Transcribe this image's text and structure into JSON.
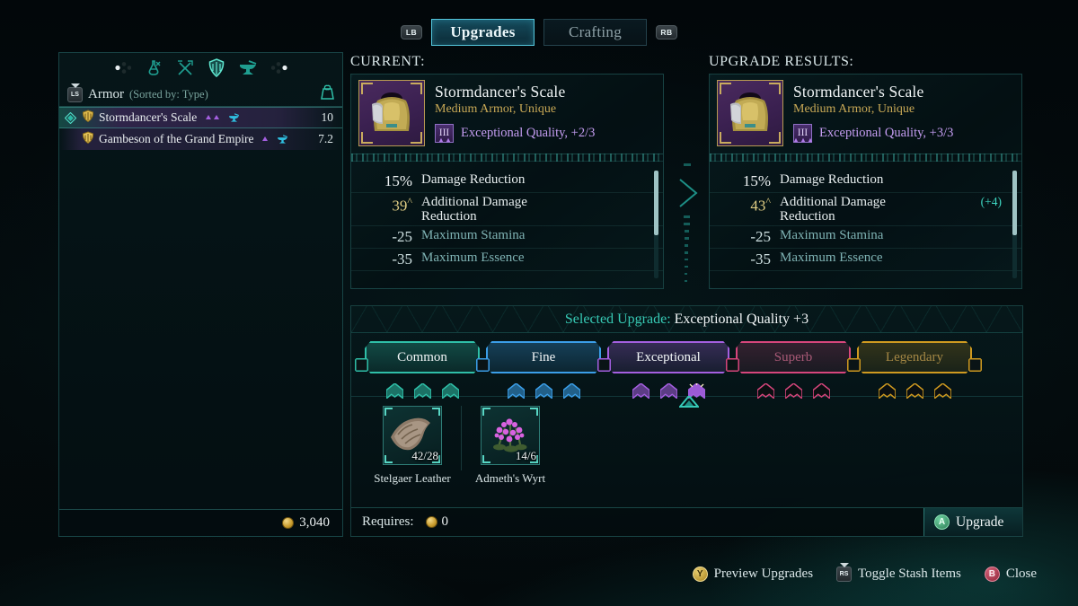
{
  "tabs": {
    "left_bumper": "LB",
    "right_bumper": "RB",
    "items": [
      {
        "label": "Upgrades",
        "active": true
      },
      {
        "label": "Crafting",
        "active": false
      }
    ]
  },
  "sidebar": {
    "categories": [
      {
        "name": "prev-category-arrow"
      },
      {
        "name": "potion-icon"
      },
      {
        "name": "weapons-icon"
      },
      {
        "name": "armor-icon"
      },
      {
        "name": "anvil-icon"
      },
      {
        "name": "next-category-arrow"
      }
    ],
    "sort": {
      "button": "LS",
      "label": "Armor",
      "sub": "(Sorted by: Type)"
    },
    "items": [
      {
        "name": "Stormdancer's Scale",
        "value": "10",
        "selected": true,
        "pips": 2
      },
      {
        "name": "Gambeson of the Grand Empire",
        "value": "7.2",
        "selected": false,
        "pips": 1
      }
    ],
    "gold": "3,040"
  },
  "current_panel": {
    "header": "CURRENT:",
    "item": {
      "title": "Stormdancer's Scale",
      "subtitle": "Medium Armor, Unique",
      "quality_rank": "III",
      "quality_pips": 2,
      "quality_text": "Exceptional Quality, +2/3"
    },
    "stats": [
      {
        "value": "15%",
        "label": "Damage Reduction",
        "value_style": "white",
        "label_style": "white",
        "delta": ""
      },
      {
        "value": "39",
        "caret": "^",
        "label": "Additional Damage Reduction",
        "value_style": "gold",
        "label_style": "white",
        "delta": ""
      },
      {
        "value": "-25",
        "label": "Maximum Stamina",
        "value_style": "teal",
        "label_style": "teal",
        "delta": ""
      },
      {
        "value": "-35",
        "label": "Maximum Essence",
        "value_style": "teal",
        "label_style": "teal",
        "delta": ""
      }
    ]
  },
  "results_panel": {
    "header": "UPGRADE RESULTS:",
    "item": {
      "title": "Stormdancer's Scale",
      "subtitle": "Medium Armor, Unique",
      "quality_rank": "III",
      "quality_pips": 3,
      "quality_text": "Exceptional Quality, +3/3"
    },
    "stats": [
      {
        "value": "15%",
        "label": "Damage Reduction",
        "value_style": "white",
        "label_style": "white",
        "delta": ""
      },
      {
        "value": "43",
        "caret": "^",
        "label": "Additional Damage Reduction",
        "value_style": "gold",
        "label_style": "white",
        "delta": "(+4)"
      },
      {
        "value": "-25",
        "label": "Maximum Stamina",
        "value_style": "teal",
        "label_style": "teal",
        "delta": ""
      },
      {
        "value": "-35",
        "label": "Maximum Essence",
        "value_style": "teal",
        "label_style": "teal",
        "delta": ""
      }
    ]
  },
  "upgrade": {
    "selected_label": "Selected Upgrade:",
    "selected_value": "Exceptional Quality +3",
    "tiers": [
      {
        "label": "Common",
        "color": "#2fbfa8",
        "filled": true,
        "dim": false,
        "chevrons": 3,
        "active_chevron": 0
      },
      {
        "label": "Fine",
        "color": "#3b9ee8",
        "filled": true,
        "dim": false,
        "chevrons": 3,
        "active_chevron": 0
      },
      {
        "label": "Exceptional",
        "color": "#a45fe0",
        "filled": true,
        "dim": false,
        "chevrons": 3,
        "active_chevron": 3
      },
      {
        "label": "Superb",
        "color": "#d6467c",
        "filled": true,
        "dim": true,
        "chevrons": 3,
        "active_chevron": 0
      },
      {
        "label": "Legendary",
        "color": "#cf9a20",
        "filled": true,
        "dim": true,
        "chevrons": 3,
        "active_chevron": 0
      }
    ],
    "materials": [
      {
        "name": "Stelgaer Leather",
        "count": "42/28",
        "icon": "leather-hide-icon"
      },
      {
        "name": "Admeth's Wyrt",
        "count": "14/6",
        "icon": "purple-flower-icon"
      }
    ],
    "requires_label": "Requires:",
    "requires_value": "0",
    "upgrade_button": "Upgrade",
    "upgrade_button_key": "A"
  },
  "hints": [
    {
      "key": "Y",
      "label": "Preview Upgrades",
      "style": "y"
    },
    {
      "key": "RS",
      "label": "Toggle Stash Items",
      "style": "stick"
    },
    {
      "key": "B",
      "label": "Close",
      "style": "b"
    }
  ]
}
